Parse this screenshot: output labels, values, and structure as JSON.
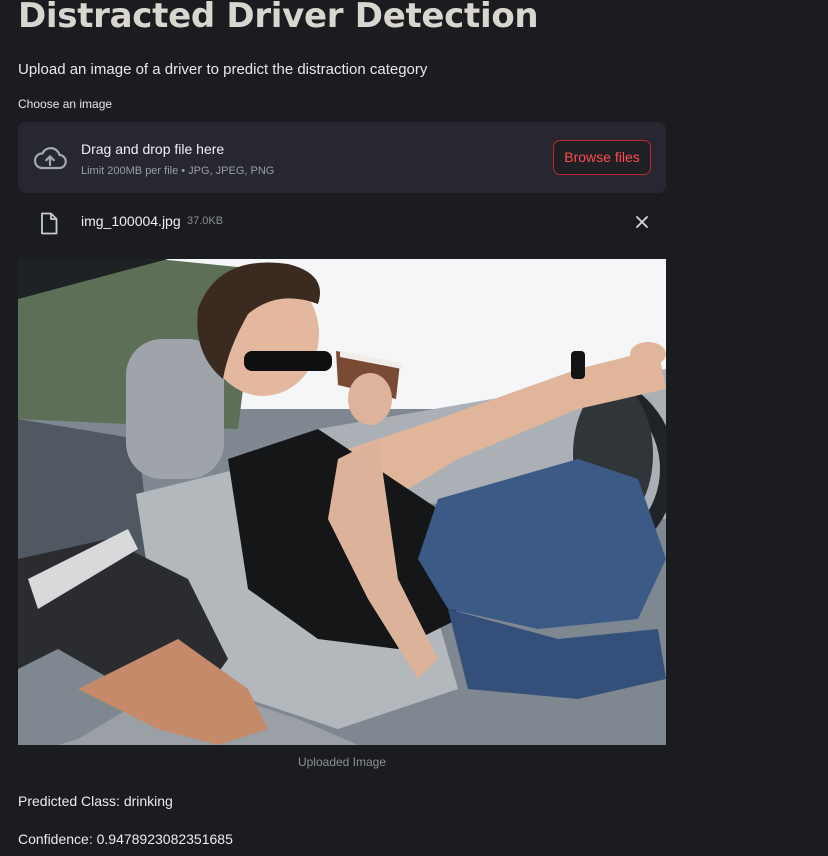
{
  "app": {
    "title": "Distracted Driver Detection",
    "subtitle": "Upload an image of a driver to predict the distraction category"
  },
  "uploader": {
    "label": "Choose an image",
    "drop_text": "Drag and drop file here",
    "limit_text": "Limit 200MB per file • JPG, JPEG, PNG",
    "browse_label": "Browse files",
    "accent_color": "#ff4b4b"
  },
  "uploaded_file": {
    "name": "img_100004.jpg",
    "size": "37.0KB",
    "icon": "file-icon",
    "remove_icon": "close-icon"
  },
  "image": {
    "caption": "Uploaded Image",
    "subject": "driver drinking from a cup while driving"
  },
  "result": {
    "predicted_class": "Predicted Class: drinking",
    "confidence": "Confidence: 0.9478923082351685"
  }
}
